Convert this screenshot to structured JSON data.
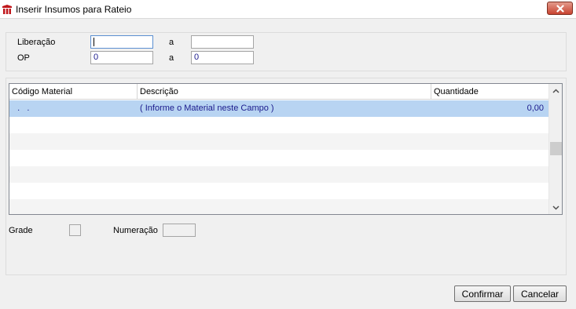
{
  "window": {
    "title": "Inserir Insumos para Rateio",
    "close_icon": "close-x"
  },
  "filters": {
    "liberacao_label": "Liberação",
    "op_label": "OP",
    "range_sep": "a",
    "liberacao_from": "",
    "liberacao_to": "",
    "op_from": "0",
    "op_to": "0"
  },
  "grid": {
    "columns": [
      "Código Material",
      "Descrição",
      "Quantidade"
    ],
    "rows": [
      {
        "codigo": "  .   .",
        "descricao": "( Informe o Material neste Campo )",
        "quantidade": "0,00"
      }
    ]
  },
  "footer": {
    "grade_label": "Grade",
    "numeracao_label": "Numeração"
  },
  "buttons": {
    "confirmar": "Confirmar",
    "cancelar": "Cancelar"
  }
}
